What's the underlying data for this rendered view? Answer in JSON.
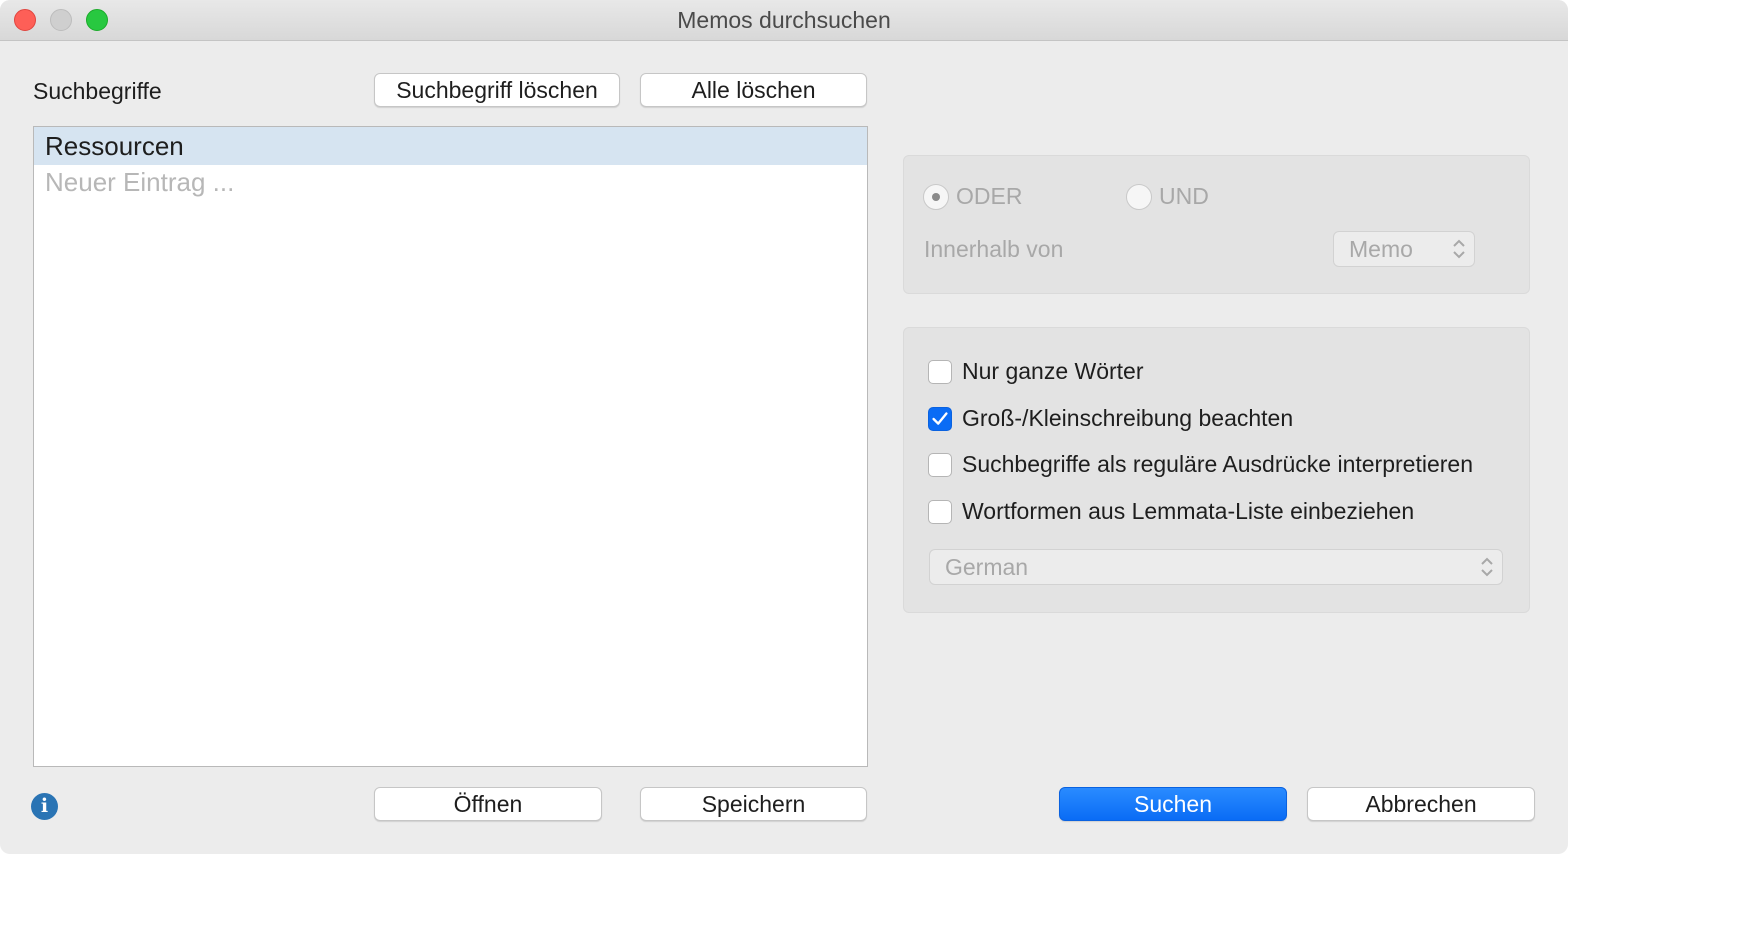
{
  "window": {
    "title": "Memos durchsuchen"
  },
  "search_terms": {
    "label": "Suchbegriffe",
    "delete_term_button": "Suchbegriff löschen",
    "delete_all_button": "Alle löschen",
    "items": [
      {
        "text": "Ressourcen",
        "selected": true
      },
      {
        "text": "Neuer Eintrag ...",
        "placeholder": true
      }
    ]
  },
  "logic": {
    "or_label": "ODER",
    "and_label": "UND",
    "selected": "ODER",
    "enabled": false,
    "within_label": "Innerhalb von",
    "within_value": "Memo"
  },
  "options": {
    "whole_words": {
      "label": "Nur ganze Wörter",
      "checked": false
    },
    "case_sensitive": {
      "label": "Groß-/Kleinschreibung beachten",
      "checked": true
    },
    "regex": {
      "label": "Suchbegriffe als reguläre Ausdrücke interpretieren",
      "checked": false
    },
    "lemmata": {
      "label": "Wortformen aus Lemmata-Liste einbeziehen",
      "checked": false
    },
    "language_value": "German"
  },
  "footer": {
    "open_button": "Öffnen",
    "save_button": "Speichern",
    "search_button": "Suchen",
    "cancel_button": "Abbrechen",
    "info_glyph": "i"
  },
  "colors": {
    "accent": "#0a6cf5",
    "selection": "#d6e4f1",
    "info": "#2a74b4"
  }
}
